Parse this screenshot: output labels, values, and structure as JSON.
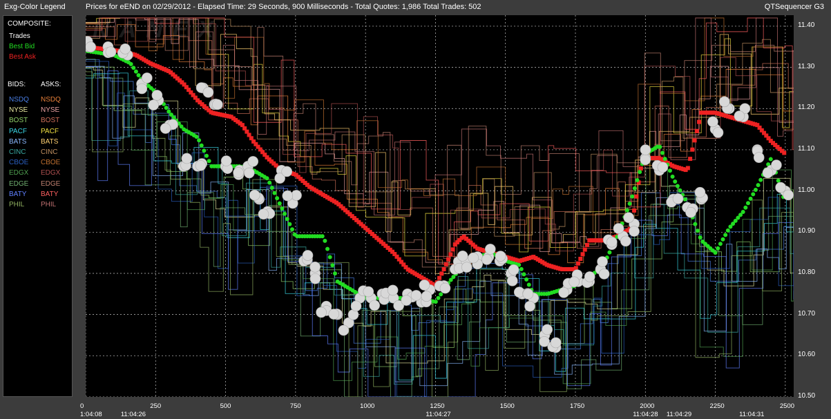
{
  "header": {
    "legend_title": "Exg-Color Legend",
    "chart_title": "Prices for  eEND  on  02/29/2012  -  Elapsed Time: 29 Seconds, 900 Milliseconds  -  Total Quotes: 1,986  Total Trades: 502",
    "app_name": "QTSequencer G3"
  },
  "legend": {
    "composite_label": "COMPOSITE:",
    "composite": [
      {
        "label": "Trades",
        "color": "#ffffff"
      },
      {
        "label": "Best Bid",
        "color": "#22dd22"
      },
      {
        "label": "Best Ask",
        "color": "#ee2222"
      }
    ],
    "bids_label": "BIDS:",
    "asks_label": "ASKS:",
    "exchanges": [
      {
        "bid": "NSDQ",
        "ask": "NSDQ",
        "bid_color": "#4a7fe6",
        "ask_color": "#e8803a"
      },
      {
        "bid": "NYSE",
        "ask": "NYSE",
        "bid_color": "#e8e8a0",
        "ask_color": "#e8a0a0"
      },
      {
        "bid": "BOST",
        "ask": "BOST",
        "bid_color": "#8fd06a",
        "ask_color": "#d0705a"
      },
      {
        "bid": "PACF",
        "ask": "PACF",
        "bid_color": "#3ad8e8",
        "ask_color": "#f0e040"
      },
      {
        "bid": "BATS",
        "ask": "BATS",
        "bid_color": "#8ab8ff",
        "ask_color": "#ffd070"
      },
      {
        "bid": "CINC",
        "ask": "CINC",
        "bid_color": "#3aa8a0",
        "ask_color": "#c09060"
      },
      {
        "bid": "CBOE",
        "ask": "CBOE",
        "bid_color": "#2a5fc0",
        "ask_color": "#c07030"
      },
      {
        "bid": "EDGX",
        "ask": "EDGX",
        "bid_color": "#50a050",
        "ask_color": "#b05050"
      },
      {
        "bid": "EDGE",
        "ask": "EDGE",
        "bid_color": "#70b070",
        "ask_color": "#c08070"
      },
      {
        "bid": "BATY",
        "ask": "BATY",
        "bid_color": "#6080ff",
        "ask_color": "#ff6060"
      },
      {
        "bid": "PHIL",
        "ask": "PHIL",
        "bid_color": "#90b060",
        "ask_color": "#c07070"
      }
    ]
  },
  "watermark": "NANEX",
  "colors": {
    "trade": "#d8d8d8",
    "best_bid": "#22dd22",
    "best_ask": "#ee2222",
    "grid": "#c8c8c8"
  },
  "chart_data": {
    "type": "line",
    "title": "Prices for  eEND  on  02/29/2012",
    "xlabel": "",
    "ylabel": "",
    "xlim": [
      0,
      2530
    ],
    "ylim": [
      10.5,
      11.42
    ],
    "grid": true,
    "y_ticks": [
      "11.40",
      "11.30",
      "11.20",
      "11.10",
      "11.00",
      "10.90",
      "10.80",
      "10.70",
      "10.60",
      "10.50"
    ],
    "x_ticks": [
      "0",
      "250",
      "500",
      "750",
      "1000",
      "1250",
      "1500",
      "1750",
      "2000",
      "2250",
      "2500"
    ],
    "time_labels": [
      {
        "x": 0,
        "label": "1:04:08"
      },
      {
        "x": 160,
        "label": "11:04:26"
      },
      {
        "x": 1250,
        "label": "11:04:27"
      },
      {
        "x": 1990,
        "label": "11:04:28"
      },
      {
        "x": 2110,
        "label": "11:04:29"
      },
      {
        "x": 2370,
        "label": "11:04:31"
      }
    ],
    "series": [
      {
        "name": "Best Ask",
        "x": [
          0,
          120,
          180,
          230,
          300,
          350,
          400,
          450,
          520,
          560,
          600,
          650,
          700,
          750,
          800,
          850,
          900,
          950,
          1000,
          1050,
          1100,
          1150,
          1200,
          1250,
          1280,
          1320,
          1350,
          1400,
          1450,
          1500,
          1550,
          1600,
          1650,
          1700,
          1750,
          1800,
          1850,
          1900,
          1950,
          1990,
          2050,
          2100,
          2150,
          2200,
          2250,
          2300,
          2350,
          2400,
          2450,
          2500
        ],
        "values": [
          11.35,
          11.34,
          11.33,
          11.31,
          11.29,
          11.26,
          11.22,
          11.19,
          11.18,
          11.16,
          11.12,
          11.08,
          11.05,
          11.04,
          11.01,
          10.99,
          10.97,
          10.94,
          10.91,
          10.88,
          10.85,
          10.81,
          10.79,
          10.77,
          10.81,
          10.87,
          10.89,
          10.86,
          10.85,
          10.84,
          10.83,
          10.84,
          10.82,
          10.81,
          10.81,
          10.88,
          10.88,
          10.89,
          10.91,
          11.08,
          11.08,
          11.06,
          11.05,
          11.19,
          11.19,
          11.18,
          11.17,
          11.16,
          11.12,
          11.09
        ]
      },
      {
        "name": "Best Bid",
        "x": [
          0,
          100,
          160,
          200,
          250,
          300,
          350,
          400,
          450,
          500,
          550,
          600,
          650,
          700,
          750,
          800,
          850,
          900,
          950,
          1000,
          1050,
          1100,
          1150,
          1200,
          1250,
          1300,
          1350,
          1400,
          1450,
          1500,
          1550,
          1600,
          1650,
          1700,
          1750,
          1800,
          1850,
          1900,
          1950,
          2000,
          2050,
          2100,
          2150,
          2200,
          2250,
          2300,
          2350,
          2400,
          2450,
          2500
        ],
        "values": [
          11.34,
          11.33,
          11.31,
          11.27,
          11.24,
          11.19,
          11.15,
          11.13,
          11.06,
          11.06,
          11.06,
          11.05,
          11.03,
          10.96,
          10.89,
          10.89,
          10.89,
          10.78,
          10.76,
          10.74,
          10.74,
          10.74,
          10.74,
          10.74,
          10.73,
          10.78,
          10.82,
          10.84,
          10.85,
          10.83,
          10.82,
          10.75,
          10.75,
          10.76,
          10.77,
          10.79,
          10.82,
          10.89,
          10.98,
          11.09,
          11.11,
          11.03,
          10.97,
          10.88,
          10.85,
          10.91,
          10.95,
          11.01,
          11.08,
          10.97
        ]
      },
      {
        "name": "Trades",
        "x": [
          10,
          80,
          150,
          200,
          260,
          300,
          350,
          400,
          420,
          460,
          500,
          550,
          580,
          620,
          650,
          700,
          740,
          780,
          820,
          860,
          900,
          940,
          980,
          1020,
          1060,
          1100,
          1150,
          1200,
          1230,
          1280,
          1320,
          1360,
          1400,
          1440,
          1480,
          1520,
          1560,
          1600,
          1640,
          1680,
          1720,
          1760,
          1800,
          1840,
          1880,
          1920,
          1960,
          2000,
          2050,
          2100,
          2150,
          2200,
          2250,
          2300,
          2350,
          2400,
          2450,
          2500
        ],
        "values": [
          11.35,
          11.35,
          11.33,
          11.26,
          11.22,
          11.16,
          11.06,
          11.06,
          11.25,
          11.21,
          11.06,
          11.05,
          11.06,
          10.98,
          10.95,
          11.05,
          10.97,
          10.83,
          10.8,
          10.72,
          10.7,
          10.68,
          10.74,
          10.74,
          10.75,
          10.74,
          10.75,
          10.73,
          10.76,
          10.77,
          10.81,
          10.83,
          10.84,
          10.84,
          10.83,
          10.8,
          10.75,
          10.74,
          10.65,
          10.62,
          10.76,
          10.78,
          10.78,
          10.81,
          10.87,
          10.89,
          10.92,
          11.08,
          11.05,
          10.98,
          10.96,
          10.98,
          11.15,
          11.2,
          11.18,
          11.1,
          11.05,
          11.0
        ]
      }
    ]
  }
}
